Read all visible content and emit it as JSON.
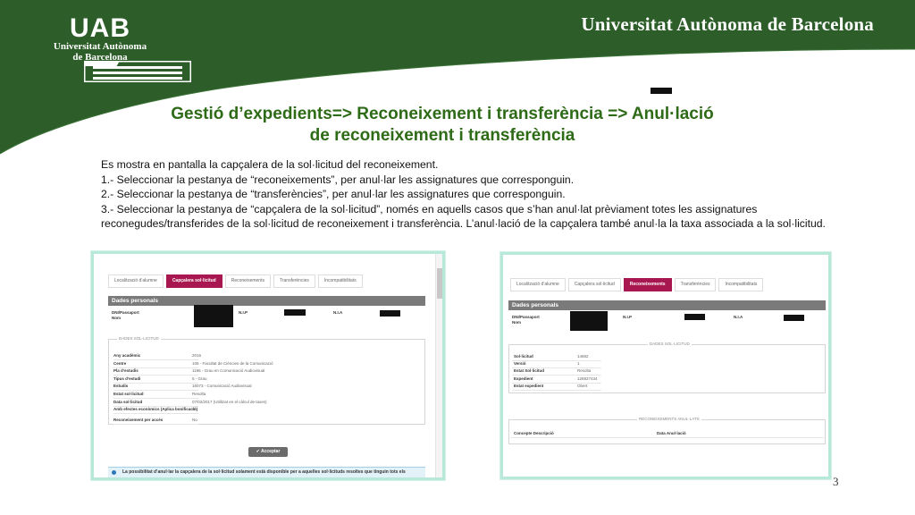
{
  "header": {
    "logo_mark": "UAB",
    "logo_name_line1": "Universitat Autònoma",
    "logo_name_line2": "de Barcelona",
    "university_name": "Universitat Autònoma de Barcelona",
    "brand_color": "#2d5e2a"
  },
  "slide": {
    "title_line1": "Gestió d’expedients=> Reconeixement i transferència => Anul·lació",
    "title_line2": "de reconeixement i transferència",
    "title_color": "#2e6b17",
    "paragraphs": [
      "Es mostra en pantalla la capçalera de la sol·licitud del reconeixement.",
      "1.- Seleccionar la pestanya de “reconeixements”, per anul·lar les assignatures que corresponguin.",
      "2.- Seleccionar la pestanya de “transferències”, per anul·lar les assignatures que corresponguin.",
      "3.- Seleccionar la pestanya de “capçalera de la sol·licitud”, només en aquells casos que s’han anul·lat prèviament totes les assignatures reconegudes/transferides de la sol·licitud de reconeixement i transferència. L’anul·lació de la capçalera també anul·la la taxa associada a la sol·licitud."
    ],
    "page_number": "3"
  },
  "screen1": {
    "tabs": [
      "Localització d’alumne",
      "Capçalera sol·licitud",
      "Reconeixements",
      "Transferències",
      "Incompatibilitats"
    ],
    "active_tab": 1,
    "accent_color": "#a8174f",
    "personal_header": "Dades personals",
    "personal_labels": [
      "DNI/Passaport",
      "Nom",
      "N.I.P",
      "N.I.A"
    ],
    "section_legend": "DADES SOL·LICITUD",
    "fields": [
      {
        "label": "Any acadèmic",
        "value": "2016"
      },
      {
        "label": "Centre",
        "value": "105 - Facultat de Ciències de la Comunicació"
      },
      {
        "label": "Pla d’estudis",
        "value": "1196 - Grau en Comunicació Audiovisual"
      },
      {
        "label": "Tipus d’estudi",
        "value": "5 - Grau"
      },
      {
        "label": "Estudis",
        "value": "16073 - Comunicació Audiovisual"
      },
      {
        "label": "Estat sol·licitud",
        "value": "Resolta"
      },
      {
        "label": "Data sol·licitud",
        "value": "07/02/2017 (Utilitzat en el càlcul de taxes)"
      },
      {
        "label": "Amb efectes econòmics (Aplica bonificació)",
        "value": "Sí"
      },
      {
        "label": "Reconeixement per accés",
        "value": "No"
      }
    ],
    "accept_button": "Acceptar",
    "info_note": "La possibilitat d’anul·lar la capçalera de la sol·licitud solament està disponible per a aquelles sol·licituds resoltes que tinguin tots els"
  },
  "screen2": {
    "tabs": [
      "Localització d’alumne",
      "Capçalera sol·licitud",
      "Reconeixements",
      "Transferències",
      "Incompatibilitats"
    ],
    "active_tab": 2,
    "personal_header": "Dades personals",
    "personal_labels": [
      "DNI/Passaport",
      "Nom",
      "N.I.P",
      "N.I.A"
    ],
    "section_legend": "DADES SOL·LICITUD",
    "fields": [
      {
        "label": "Sol·licitud",
        "value": "14682"
      },
      {
        "label": "Versió",
        "value": "1"
      },
      {
        "label": "Estat Sol·licitud",
        "value": "Resolta"
      },
      {
        "label": "Expedient",
        "value": "126827434"
      },
      {
        "label": "Estat expedient",
        "value": "Obert"
      }
    ],
    "recog_legend": "RECONEIXEMENTS ANUL·LATS",
    "recog_columns": [
      "Concepte Descripció",
      "Data Anul·lació"
    ]
  }
}
